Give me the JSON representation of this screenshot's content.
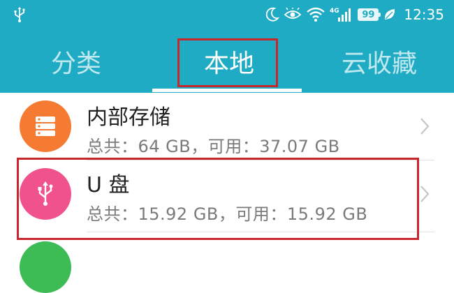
{
  "status_bar": {
    "time": "12:35",
    "battery": "99",
    "network": "4G",
    "icons": [
      "usb-icon",
      "moon-icon",
      "eye-icon",
      "wifi-icon",
      "signal-icon",
      "battery-icon",
      "leaf-icon"
    ]
  },
  "tabs": [
    {
      "label": "分类"
    },
    {
      "label": "本地"
    },
    {
      "label": "云收藏"
    }
  ],
  "storage_items": [
    {
      "title": "内部存储",
      "detail": "总共：64 GB，可用：37.07 GB",
      "icon": "server-icon",
      "color": "#f57b33"
    },
    {
      "title": "U 盘",
      "detail": "总共：15.92 GB，可用：15.92 GB",
      "icon": "usb-icon",
      "color": "#f0528d"
    }
  ],
  "colors": {
    "header": "#1fabc4",
    "highlight": "#c8262b",
    "next_item": "#3dbb55"
  }
}
